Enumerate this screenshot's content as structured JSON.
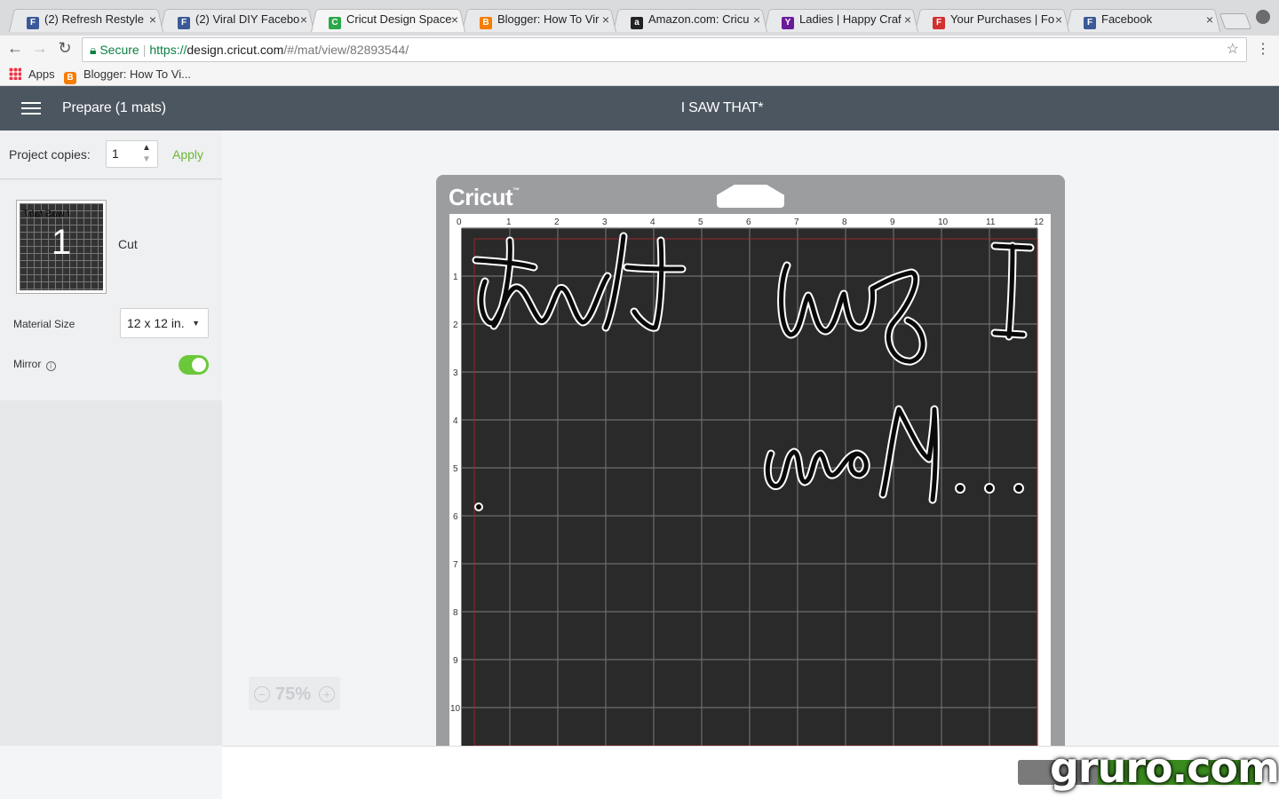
{
  "browser": {
    "tabs": [
      {
        "title": "(2) Refresh Restyle",
        "favicon": "F",
        "color": "#3b5998",
        "active": false
      },
      {
        "title": "(2) Viral DIY Facebo",
        "favicon": "F",
        "color": "#3b5998",
        "active": false
      },
      {
        "title": "Cricut Design Space",
        "favicon": "C",
        "color": "#2aa84a",
        "active": true
      },
      {
        "title": "Blogger: How To Vir",
        "favicon": "B",
        "color": "#f57d00",
        "active": false
      },
      {
        "title": "Amazon.com: Cricu",
        "favicon": "a",
        "color": "#222222",
        "active": false
      },
      {
        "title": "Ladies | Happy Craf",
        "favicon": "Y",
        "color": "#6a1b9a",
        "active": false
      },
      {
        "title": "Your Purchases | Fo",
        "favicon": "F",
        "color": "#d32f2f",
        "active": false
      },
      {
        "title": "Facebook",
        "favicon": "F",
        "color": "#3b5998",
        "active": false
      }
    ],
    "close_glyph": "×",
    "url": {
      "secure": "Secure",
      "scheme": "https://",
      "host": "design.cricut.com",
      "path": "/#/mat/view/82893544/"
    },
    "bookmarks": [
      {
        "label": "Apps"
      },
      {
        "label": "Blogger: How To Vi..."
      }
    ]
  },
  "app": {
    "title": "Prepare (1 mats)",
    "project_name": "I SAW THAT*"
  },
  "panel": {
    "copies_label": "Project copies:",
    "copies_value": "1",
    "apply_label": "Apply",
    "mat_number": "1",
    "mat_mode": "Cut",
    "material_size_label": "Material Size",
    "material_size_value": "12 x 12 in.",
    "mirror_label": "Mirror",
    "mirror_on": true
  },
  "zoom": {
    "value": "75%",
    "minus": "−",
    "plus": "+"
  },
  "mat": {
    "brand": "Cricut",
    "trademark": "™",
    "ruler_top": [
      "0",
      "1",
      "2",
      "3",
      "4",
      "5",
      "6",
      "7",
      "8",
      "9",
      "10",
      "11",
      "12"
    ],
    "ruler_left": [
      "1",
      "2",
      "3",
      "4",
      "5",
      "6",
      "7",
      "8",
      "9",
      "10"
    ]
  },
  "colors": {
    "header": "#4b5660",
    "accent_green": "#6bb833",
    "mat_dark": "#2a2a2a"
  },
  "watermark": {
    "text": "gruro.com"
  }
}
